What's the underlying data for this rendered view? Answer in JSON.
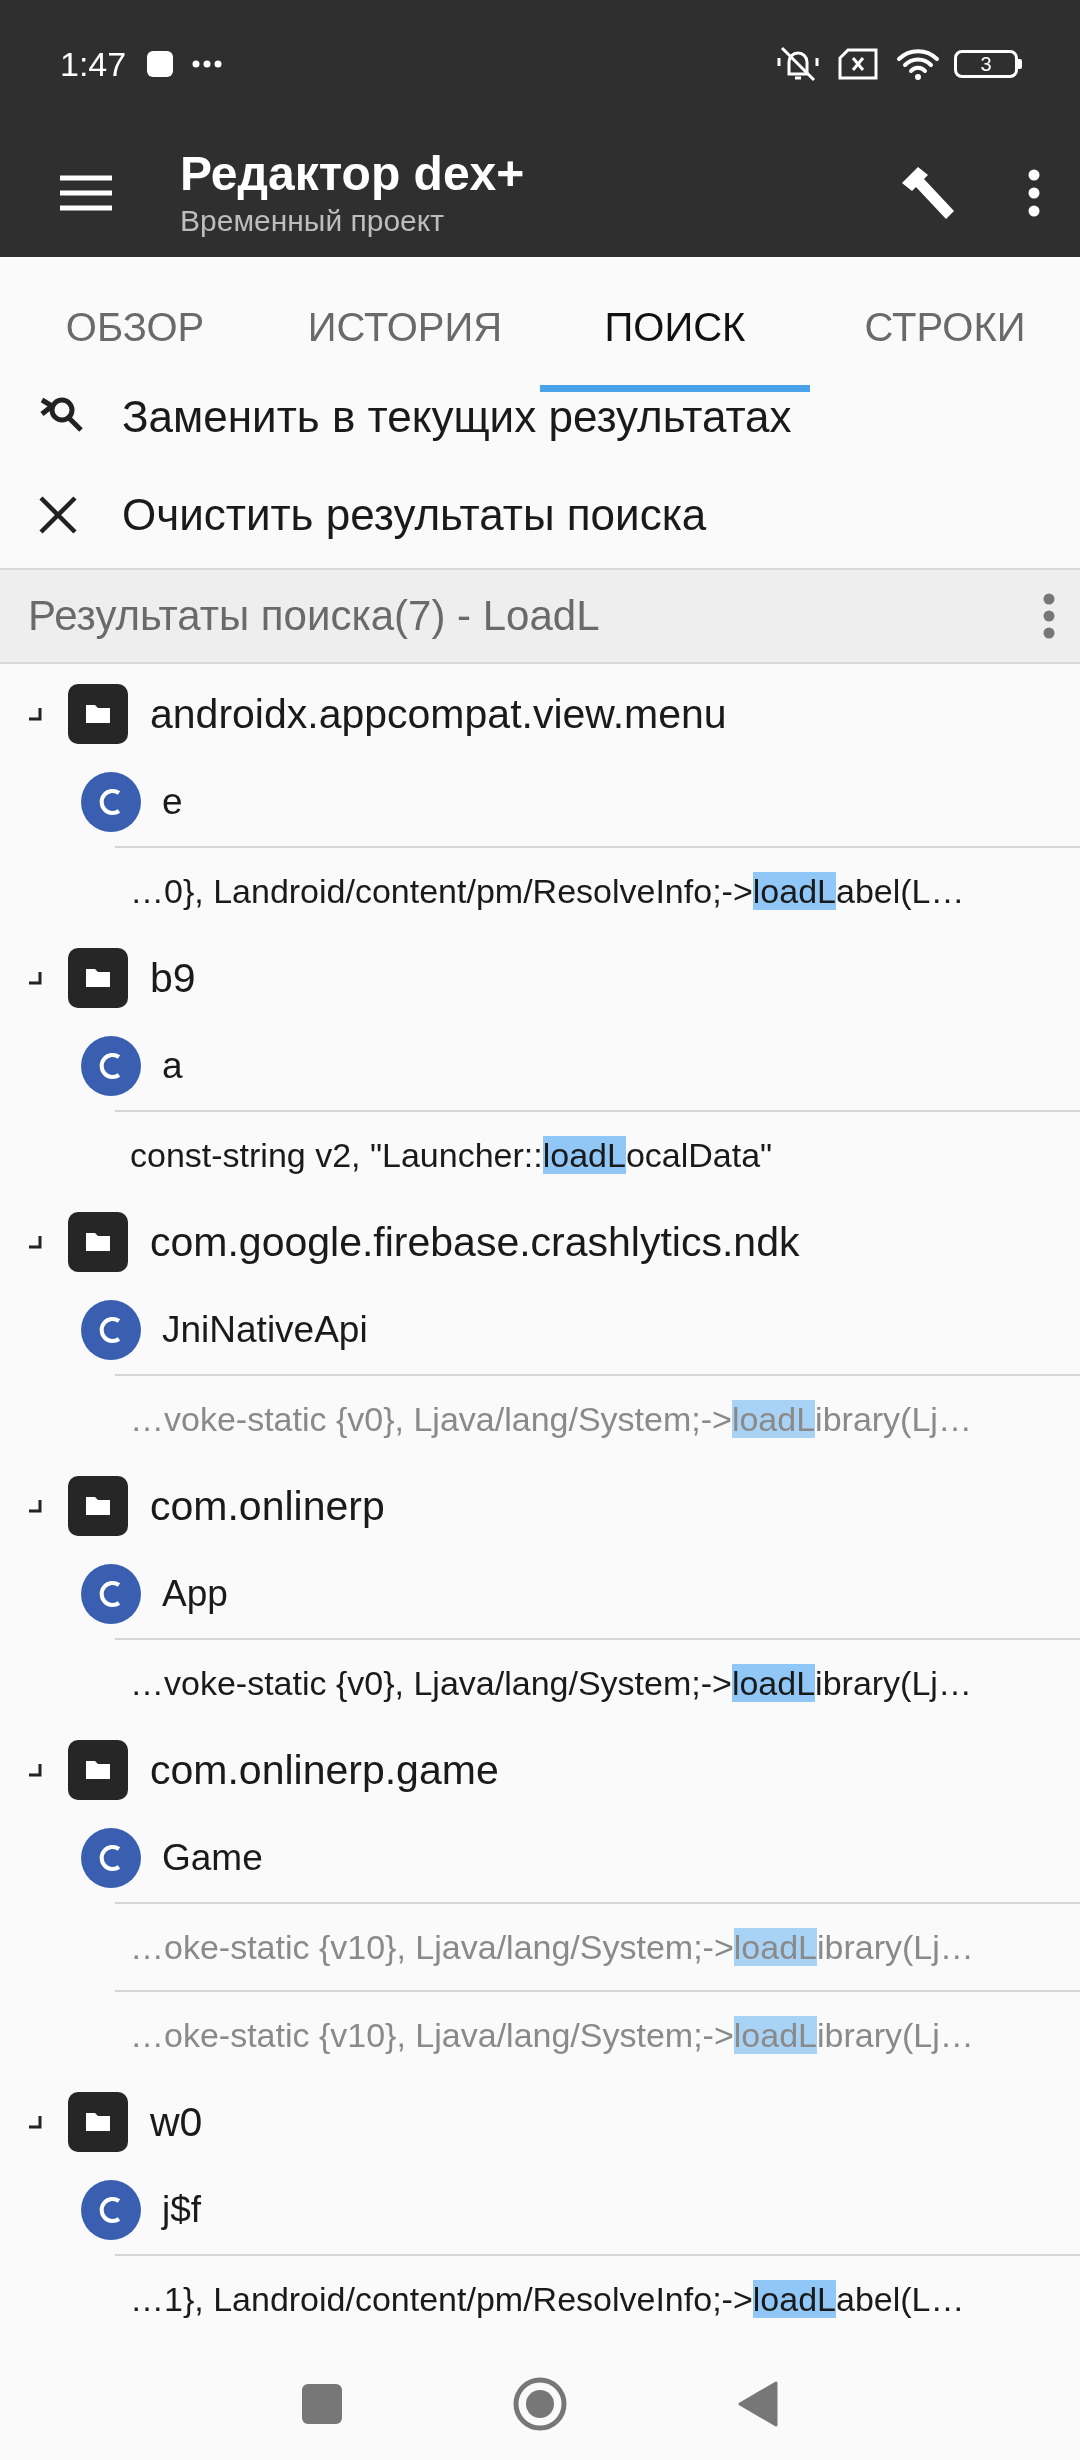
{
  "status_bar": {
    "time": "1:47",
    "battery": "3"
  },
  "toolbar": {
    "title": "Редактор dex+",
    "subtitle": "Временный проект"
  },
  "tabs": [
    {
      "label": "ОБЗОР",
      "selected": false
    },
    {
      "label": "ИСТОРИЯ",
      "selected": false
    },
    {
      "label": "ПОИСК",
      "selected": true
    },
    {
      "label": "СТРОКИ",
      "selected": false
    }
  ],
  "actions": [
    {
      "kind": "replace",
      "label": "Заменить в текущих результатах"
    },
    {
      "kind": "clear",
      "label": "Очистить результаты поиска"
    }
  ],
  "results": {
    "title": "Результаты поиска(7) - LoadL",
    "packages": [
      {
        "name": "androidx.appcompat.view.menu",
        "children": [
          {
            "name": "e",
            "children": [
              {
                "before": "…0}, Landroid/content/pm/ResolveInfo;->",
                "match": "loadL",
                "after": "abel(L…",
                "dimmed": false
              }
            ]
          }
        ]
      },
      {
        "name": "b9",
        "children": [
          {
            "name": "a",
            "children": [
              {
                "before": "const-string v2, \"Launcher::",
                "match": "loadL",
                "after": "ocalData\"",
                "dimmed": false
              }
            ]
          }
        ]
      },
      {
        "name": "com.google.firebase.crashlytics.ndk",
        "children": [
          {
            "name": "JniNativeApi",
            "children": [
              {
                "before": "…voke-static {v0}, Ljava/lang/System;->",
                "match": "loadL",
                "after": "ibrary(Lj…",
                "dimmed": true
              }
            ]
          }
        ]
      },
      {
        "name": "com.onlinerp",
        "children": [
          {
            "name": "App",
            "children": [
              {
                "before": "…voke-static {v0}, Ljava/lang/System;->",
                "match": "loadL",
                "after": "ibrary(Lj…",
                "dimmed": false
              }
            ]
          }
        ]
      },
      {
        "name": "com.onlinerp.game",
        "children": [
          {
            "name": "Game",
            "children": [
              {
                "before": "…oke-static {v10}, Ljava/lang/System;->",
                "match": "loadL",
                "after": "ibrary(Lj…",
                "dimmed": true
              },
              {
                "before": "…oke-static {v10}, Ljava/lang/System;->",
                "match": "loadL",
                "after": "ibrary(Lj…",
                "dimmed": true
              }
            ]
          }
        ]
      },
      {
        "name": "w0",
        "children": [
          {
            "name": "j$f",
            "children": [
              {
                "before": "…1}, Landroid/content/pm/ResolveInfo;->",
                "match": "loadL",
                "after": "abel(L…",
                "dimmed": false
              }
            ]
          }
        ]
      }
    ]
  }
}
